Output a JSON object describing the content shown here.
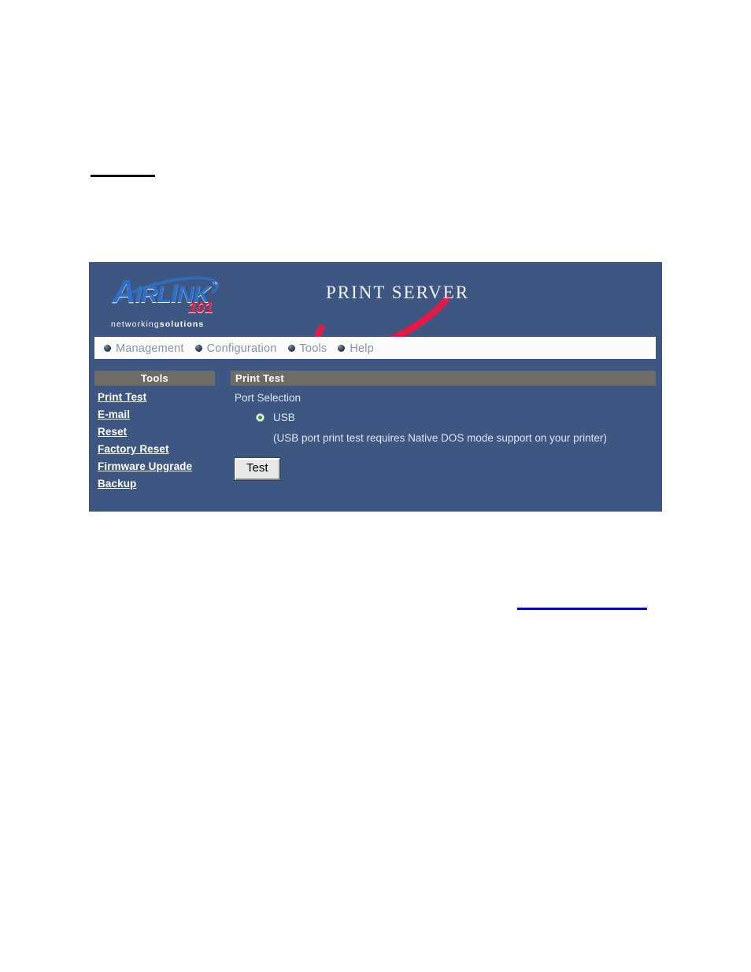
{
  "page": {
    "heading_rule": "",
    "link_rule": ""
  },
  "branding": {
    "logo_cap": "A",
    "logo_rest": "IRL",
    "logo_cap2": "I",
    "logo_wordmark": "AIRLINK",
    "logo_trademark": "™",
    "logo_model": "101",
    "tagline_light": "networking",
    "tagline_bold": "solutions",
    "product_title": "PRINT SERVER",
    "product_title_caps": "PS",
    "product_title_small": "RINT ERVER"
  },
  "nav": {
    "items": [
      {
        "label": "Management",
        "icon": "bullet-icon"
      },
      {
        "label": "Configuration",
        "icon": "bullet-icon"
      },
      {
        "label": "Tools",
        "icon": "bullet-icon"
      },
      {
        "label": "Help",
        "icon": "bullet-icon"
      }
    ]
  },
  "sidebar": {
    "title": "Tools",
    "items": [
      {
        "label": "Print Test"
      },
      {
        "label": "E-mail"
      },
      {
        "label": "Reset"
      },
      {
        "label": "Factory Reset"
      },
      {
        "label": "Firmware Upgrade"
      },
      {
        "label": "Backup"
      }
    ]
  },
  "content": {
    "title": "Print Test",
    "port_selection_label": "Port Selection",
    "port_option": "USB",
    "port_option_selected": true,
    "usb_note": "(USB port print test requires Native DOS mode support on your printer)",
    "test_button": "Test"
  },
  "colors": {
    "panel_background": "#3d5682",
    "header_bar": "#6d6c66",
    "nav_bar": "#fbfbfb",
    "nav_text": "#8795ab",
    "logo_blue": "#2f6fc4",
    "logo_red": "#e01a38",
    "swoosh_red": "#e31a46",
    "radio_dot_green": "#18a318",
    "link_text": "#ffffff",
    "redaction_black": "#000000",
    "redaction_blue": "#0000d8"
  }
}
